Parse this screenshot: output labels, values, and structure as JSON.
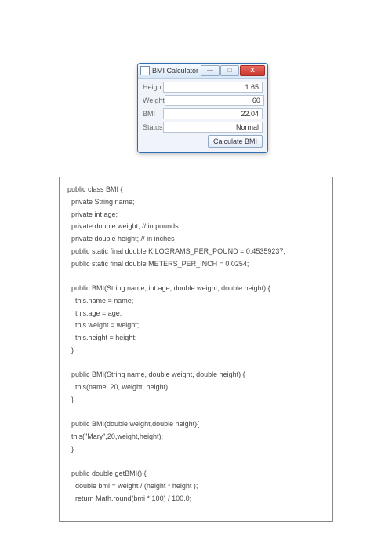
{
  "window": {
    "title": "BMI Calculator",
    "minimize_glyph": "—",
    "maximize_glyph": "□",
    "close_glyph": "X",
    "rows": [
      {
        "label": "Height",
        "value": "1.65"
      },
      {
        "label": "Weight",
        "value": "60"
      },
      {
        "label": "BMI",
        "value": "22.04"
      },
      {
        "label": "Status",
        "value": "Normal"
      }
    ],
    "button_label": "Calculate BMI"
  },
  "code": "public class BMI {\n  private String name;\n  private int age;\n  private double weight; // in pounds\n  private double height; // in inches\n  public static final double KILOGRAMS_PER_POUND = 0.45359237;\n  public static final double METERS_PER_INCH = 0.0254;\n\n  public BMI(String name, int age, double weight, double height) {\n    this.name = name;\n    this.age = age;\n    this.weight = weight;\n    this.height = height;\n  }\n\n  public BMI(String name, double weight, double height) {\n    this(name, 20, weight, height);\n  }\n\n  public BMI(double weight,double height){\n  this(\"Mary\",20,weight,height);\n  }\n\n  public double getBMI() {\n    double bmi = weight / (height * height );\n    return Math.round(bmi * 100) / 100.0;"
}
